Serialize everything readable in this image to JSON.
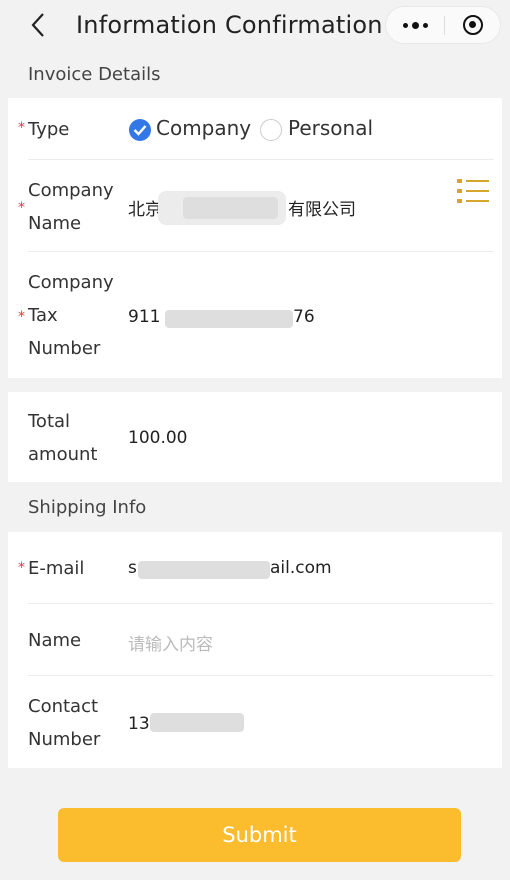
{
  "navbar": {
    "title": "Information Confirmation"
  },
  "invoice": {
    "section_title": "Invoice Details",
    "type_label": "Type",
    "type_options": [
      "Company",
      "Personal"
    ],
    "type_selected": "Company",
    "company_name_label_1": "Company",
    "company_name_label_2": "Name",
    "company_name_prefix": "北京",
    "company_name_suffix": "有限公司",
    "tax_label_1": "Company",
    "tax_label_2": "Tax",
    "tax_label_3": "Number",
    "tax_prefix": "911",
    "tax_suffix": "76",
    "amount_label_1": "Total",
    "amount_label_2": "amount",
    "amount_value": "100.00"
  },
  "shipping": {
    "section_title": "Shipping Info",
    "email_label": "E-mail",
    "email_prefix": "s",
    "email_suffix": "ail.com",
    "name_label": "Name",
    "name_placeholder": "请输入内容",
    "contact_label_1": "Contact",
    "contact_label_2": "Number",
    "contact_prefix": "13"
  },
  "actions": {
    "submit_label": "Submit"
  },
  "colors": {
    "accent": "#3478e8",
    "submit": "#fbbc2e",
    "required": "#e33333",
    "list_icon": "#d4a72c"
  },
  "icons": [
    "back-arrow-icon",
    "more-dots-icon",
    "close-capsule-icon",
    "check-icon",
    "list-icon"
  ]
}
